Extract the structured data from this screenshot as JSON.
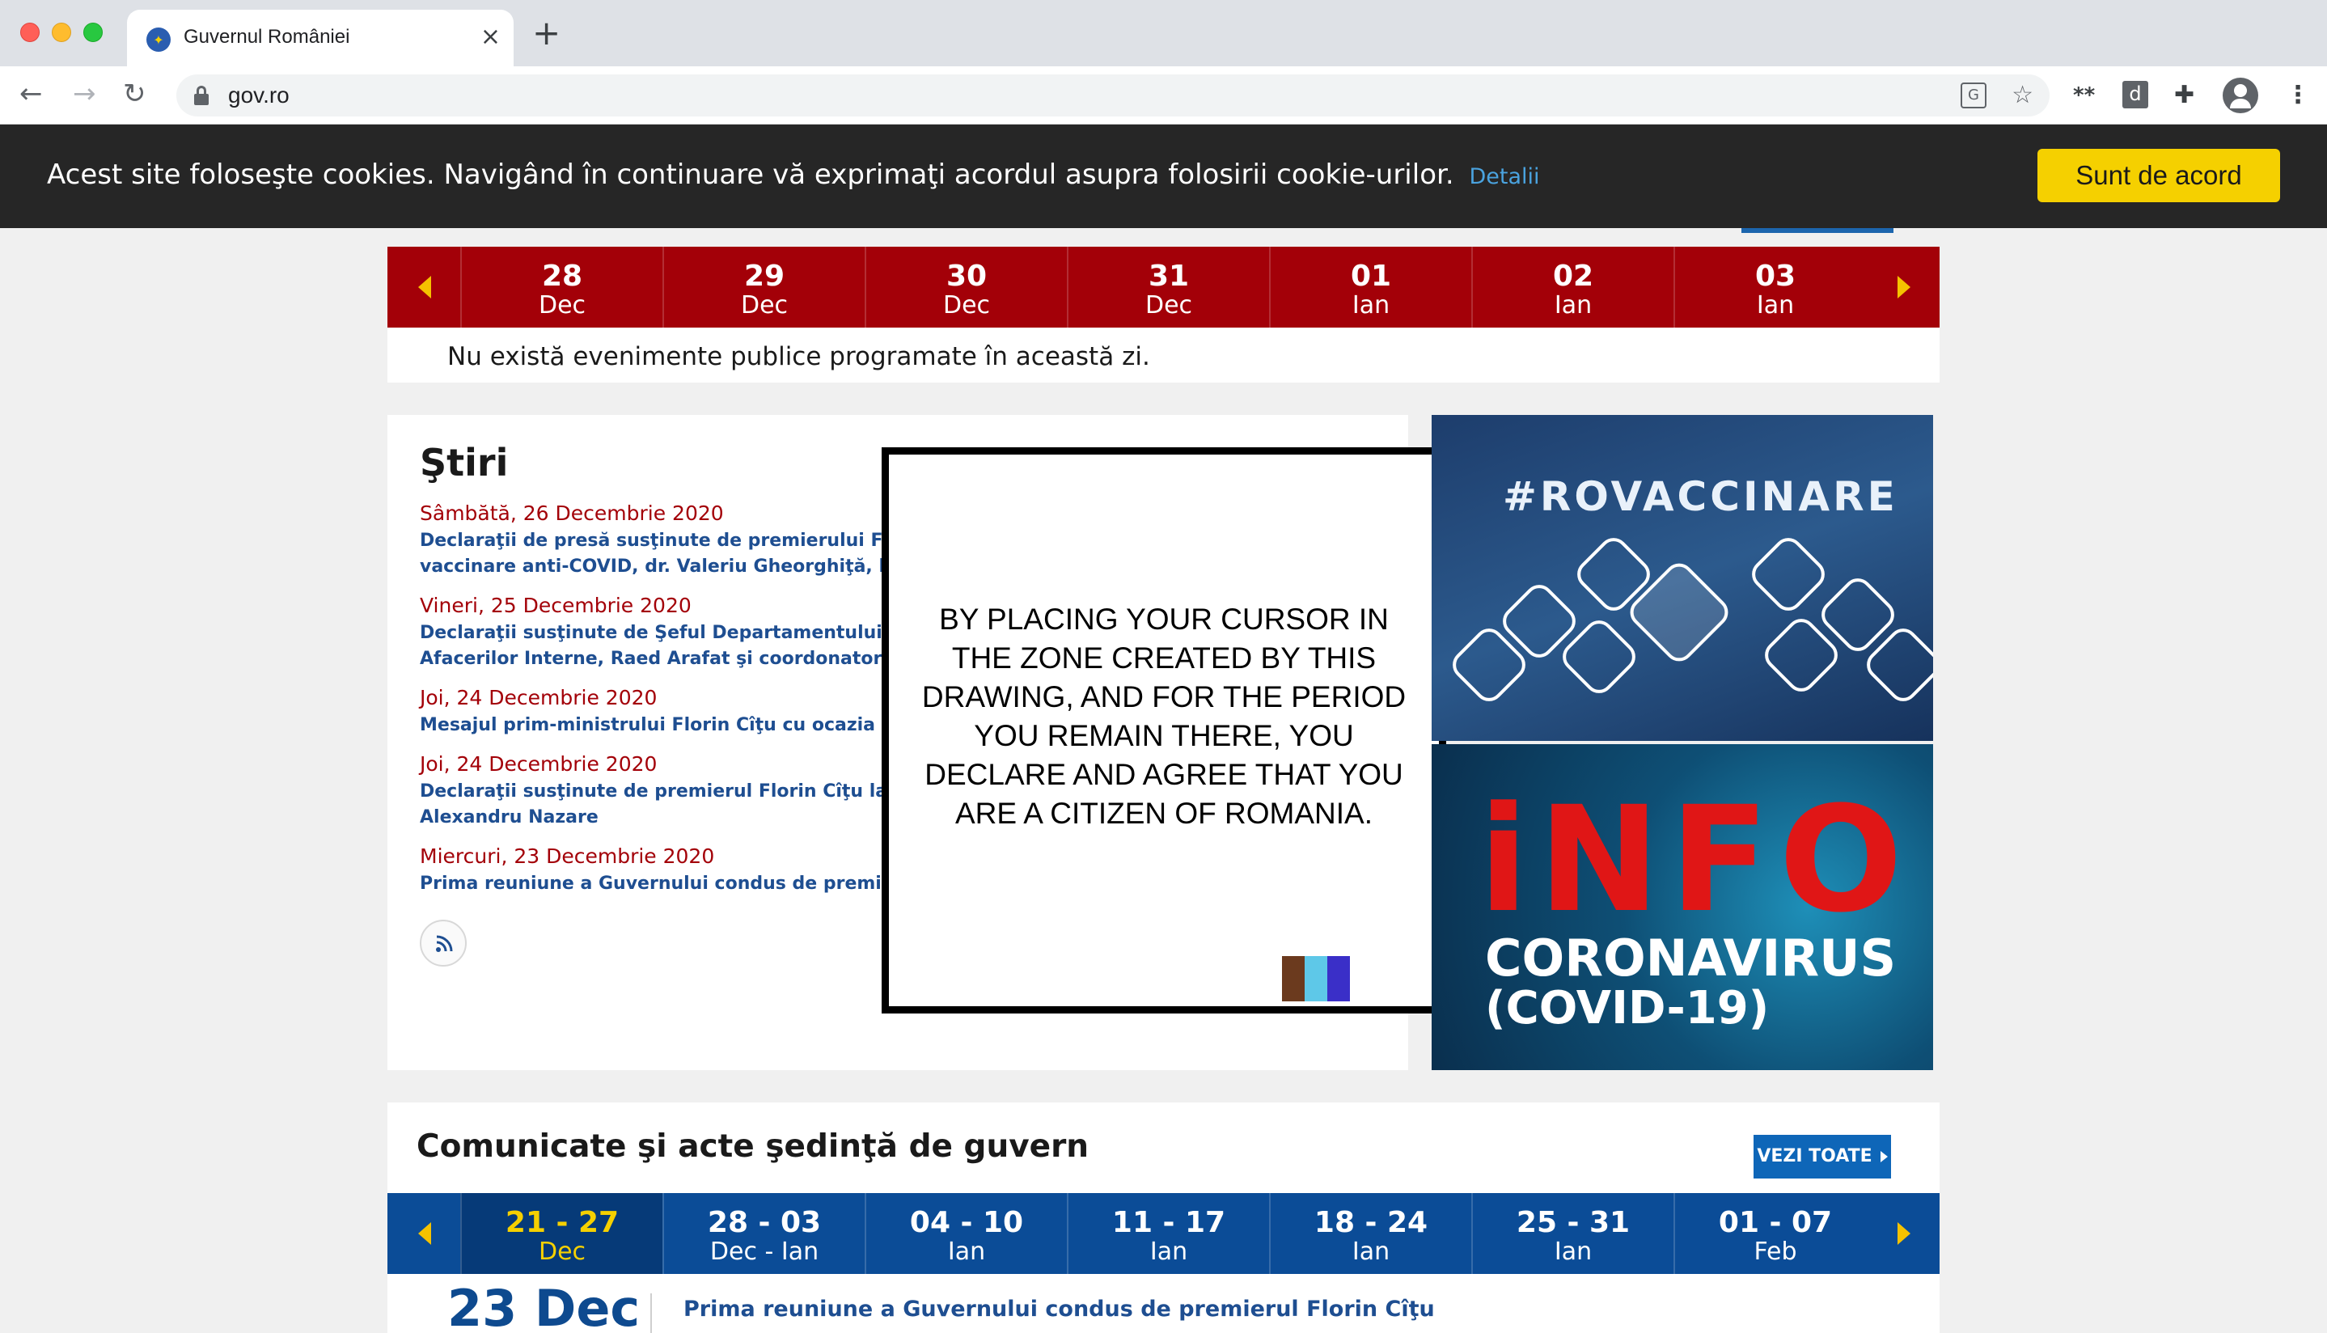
{
  "browser": {
    "tab_title": "Guvernul României",
    "url": "gov.ro"
  },
  "cookie_bar": {
    "message": "Acest site foloseşte cookies. Navigând în continuare vă exprimaţi acordul asupra folosirii cookie-urilor.",
    "details_link": "Detalii",
    "accept_button": "Sunt de acord"
  },
  "events_calendar": {
    "days": [
      {
        "num": "28",
        "month": "Dec"
      },
      {
        "num": "29",
        "month": "Dec"
      },
      {
        "num": "30",
        "month": "Dec"
      },
      {
        "num": "31",
        "month": "Dec"
      },
      {
        "num": "01",
        "month": "Ian"
      },
      {
        "num": "02",
        "month": "Ian"
      },
      {
        "num": "03",
        "month": "Ian"
      }
    ],
    "no_events_text": "Nu există evenimente publice programate în această zi."
  },
  "news": {
    "title": "Ştiri",
    "items": [
      {
        "date": "Sâmbătă, 26 Decembrie 2020",
        "lines": [
          "Declaraţii de presă susţinute de premierului F",
          "vaccinare anti-COVID, dr. Valeriu Gheorghiţă, la so"
        ]
      },
      {
        "date": "Vineri, 25 Decembrie 2020",
        "lines": [
          "Declaraţii susţinute de Şeful Departamentului pen",
          "Afacerilor Interne, Raed Arafat şi coordonatorul(..."
        ]
      },
      {
        "date": "Joi, 24 Decembrie 2020",
        "lines": [
          "Mesajul prim-ministrului Florin Cîţu cu ocazia Crăc"
        ]
      },
      {
        "date": "Joi, 24 Decembrie 2020",
        "lines": [
          "Declaraţii susţinute de premierul Florin Cîţu la pre",
          "Alexandru Nazare"
        ]
      },
      {
        "date": "Miercuri, 23 Decembrie 2020",
        "lines": [
          "Prima reuniune a Guvernului condus de premierul"
        ]
      }
    ]
  },
  "overlay": {
    "text": "BY PLACING YOUR CURSOR IN THE ZONE CREATED BY THIS DRAWING, AND FOR THE PERIOD YOU REMAIN THERE, YOU DECLARE AND AGREE THAT YOU ARE A CITIZEN OF ROMANIA.",
    "flag_colors": [
      "#6b3a1e",
      "#5ec8e8",
      "#3a2fc8"
    ]
  },
  "banners": {
    "vaccination_hashtag": "#ROVACCINARE",
    "covid_info": "iNFO",
    "covid_line1": "CORONAVIRUS",
    "covid_line2": "(COVID-19)"
  },
  "communiques": {
    "title": "Comunicate şi acte şedinţă de guvern",
    "see_all": "VEZI TOATE",
    "weeks": [
      {
        "range": "21 - 27",
        "month": "Dec",
        "active": true
      },
      {
        "range": "28 - 03",
        "month": "Dec - Ian"
      },
      {
        "range": "04 - 10",
        "month": "Ian"
      },
      {
        "range": "11 - 17",
        "month": "Ian"
      },
      {
        "range": "18 - 24",
        "month": "Ian"
      },
      {
        "range": "25 - 31",
        "month": "Ian"
      },
      {
        "range": "01 - 07",
        "month": "Feb"
      }
    ],
    "first_entry_date": "23 Dec",
    "first_entry_title": "Prima reuniune a Guvernului condus de premierul Florin Cîţu"
  },
  "colors": {
    "calendar_red": "#a30008",
    "calendar_blue": "#0b4c97",
    "accent_yellow": "#f5d000",
    "link_blue": "#1e4e91"
  }
}
